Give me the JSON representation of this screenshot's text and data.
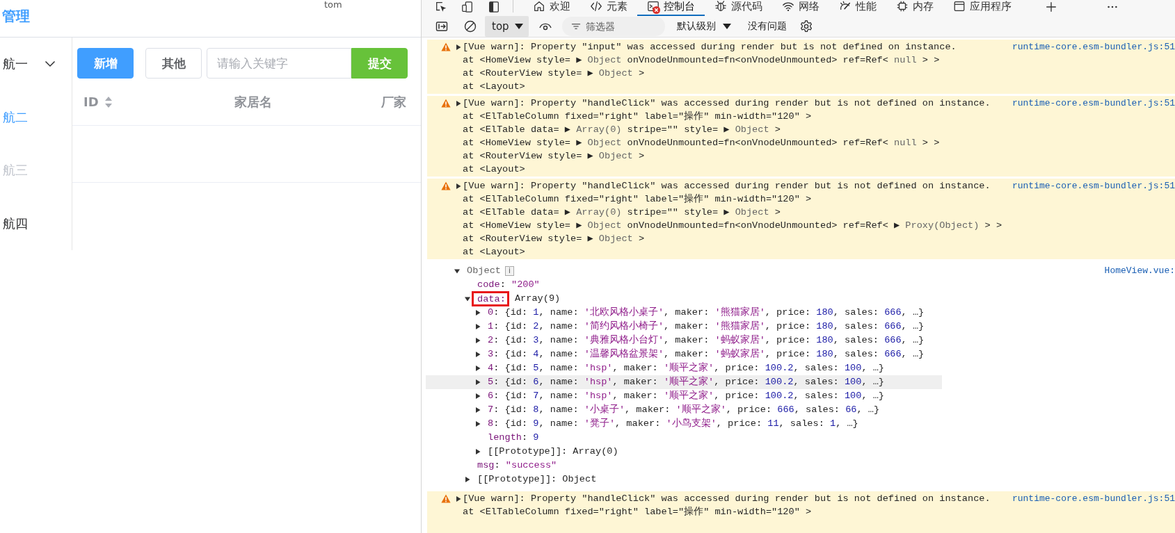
{
  "app": {
    "title": "管理",
    "user": "tom",
    "sidebar": [
      {
        "label": "航一",
        "selected": false,
        "disabled": false,
        "expanded": false,
        "kind": "submenu"
      },
      {
        "label": "航二",
        "selected": true,
        "disabled": false,
        "kind": "item"
      },
      {
        "label": "航三",
        "selected": false,
        "disabled": true,
        "kind": "item"
      },
      {
        "label": "航四",
        "selected": false,
        "disabled": false,
        "kind": "item"
      }
    ],
    "toolbar": {
      "buttons": [
        {
          "label": "新增",
          "kind": "primary"
        },
        {
          "label": "其他",
          "kind": "default"
        }
      ],
      "search": {
        "placeholder": "请输入关键字"
      },
      "submit": {
        "label": "提交",
        "kind": "success"
      }
    },
    "table": {
      "columns": [
        {
          "label": "ID",
          "sortable": true
        },
        {
          "label": "家居名",
          "sortable": false
        },
        {
          "label": "厂家",
          "sortable": false
        }
      ]
    }
  },
  "devtools": {
    "tabs": [
      {
        "label": "欢迎",
        "selected": false,
        "error_badge": false
      },
      {
        "label": "元素",
        "selected": false,
        "error_badge": false
      },
      {
        "label": "控制台",
        "selected": true,
        "error_badge": true
      },
      {
        "label": "源代码",
        "selected": false,
        "error_badge": false
      },
      {
        "label": "网络",
        "selected": false,
        "error_badge": false
      },
      {
        "label": "性能",
        "selected": false,
        "error_badge": false
      },
      {
        "label": "内存",
        "selected": false,
        "error_badge": false
      },
      {
        "label": "应用程序",
        "selected": false,
        "error_badge": false
      }
    ],
    "console_toolbar": {
      "context": "top",
      "filter": {
        "placeholder": "筛选器"
      },
      "level": "默认级别",
      "issues": "没有问题"
    },
    "messages": [
      {
        "kind": "warning",
        "collapsed": true,
        "source": "runtime-core.esm-bundler.js:51",
        "lines": [
          [
            {
              "kind": "plain",
              "text": "[Vue warn]: Property \"input\" was accessed during render but is not defined on instance."
            }
          ],
          [
            {
              "kind": "plain",
              "text": "at <HomeView style= ▶ "
            },
            {
              "kind": "dim",
              "text": "Object"
            },
            {
              "kind": "plain",
              "text": " onVnodeUnmounted=fn<onVnodeUnmounted> ref=Ref< "
            },
            {
              "kind": "dim",
              "text": "null"
            },
            {
              "kind": "plain",
              "text": " > >"
            }
          ],
          [
            {
              "kind": "plain",
              "text": "at <RouterView style= ▶ "
            },
            {
              "kind": "dim",
              "text": "Object"
            },
            {
              "kind": "plain",
              "text": " >"
            }
          ],
          [
            {
              "kind": "plain",
              "text": "at <Layout>"
            }
          ]
        ]
      },
      {
        "kind": "warning",
        "collapsed": true,
        "source": "runtime-core.esm-bundler.js:51",
        "lines": [
          [
            {
              "kind": "plain",
              "text": "[Vue warn]: Property \"handleClick\" was accessed during render but is not defined on instance."
            }
          ],
          [
            {
              "kind": "plain",
              "text": "at <ElTableColumn fixed=\"right\" label=\"操作\" min-width=\"120\" >"
            }
          ],
          [
            {
              "kind": "plain",
              "text": "at <ElTable data= ▶ "
            },
            {
              "kind": "dim",
              "text": "Array(0)"
            },
            {
              "kind": "plain",
              "text": " stripe=\"\" style= ▶ "
            },
            {
              "kind": "dim",
              "text": "Object"
            },
            {
              "kind": "plain",
              "text": " >"
            }
          ],
          [
            {
              "kind": "plain",
              "text": "at <HomeView style= ▶ "
            },
            {
              "kind": "dim",
              "text": "Object"
            },
            {
              "kind": "plain",
              "text": " onVnodeUnmounted=fn<onVnodeUnmounted> ref=Ref< "
            },
            {
              "kind": "dim",
              "text": "null"
            },
            {
              "kind": "plain",
              "text": " > >"
            }
          ],
          [
            {
              "kind": "plain",
              "text": "at <RouterView style= ▶ "
            },
            {
              "kind": "dim",
              "text": "Object"
            },
            {
              "kind": "plain",
              "text": " >"
            }
          ],
          [
            {
              "kind": "plain",
              "text": "at <Layout>"
            }
          ]
        ]
      },
      {
        "kind": "warning",
        "collapsed": true,
        "source": "runtime-core.esm-bundler.js:51",
        "lines": [
          [
            {
              "kind": "plain",
              "text": "[Vue warn]: Property \"handleClick\" was accessed during render but is not defined on instance."
            }
          ],
          [
            {
              "kind": "plain",
              "text": "at <ElTableColumn fixed=\"right\" label=\"操作\" min-width=\"120\" >"
            }
          ],
          [
            {
              "kind": "plain",
              "text": "at <ElTable data= ▶ "
            },
            {
              "kind": "dim",
              "text": "Array(0)"
            },
            {
              "kind": "plain",
              "text": " stripe=\"\" style= ▶ "
            },
            {
              "kind": "dim",
              "text": "Object"
            },
            {
              "kind": "plain",
              "text": " >"
            }
          ],
          [
            {
              "kind": "plain",
              "text": "at <HomeView style= ▶ "
            },
            {
              "kind": "dim",
              "text": "Object"
            },
            {
              "kind": "plain",
              "text": " onVnodeUnmounted=fn<onVnodeUnmounted> ref=Ref< ▶ "
            },
            {
              "kind": "dim",
              "text": "Proxy(Object)"
            },
            {
              "kind": "plain",
              "text": " > >"
            }
          ],
          [
            {
              "kind": "plain",
              "text": "at <RouterView style= ▶ "
            },
            {
              "kind": "dim",
              "text": "Object"
            },
            {
              "kind": "plain",
              "text": " >"
            }
          ],
          [
            {
              "kind": "plain",
              "text": "at <Layout>"
            }
          ]
        ]
      },
      {
        "kind": "object",
        "source": "HomeView.vue:",
        "rows": [
          {
            "segs": [
              {
                "kind": "dim",
                "text": "Object"
              }
            ],
            "badge": "i",
            "expanded": true,
            "hovered": false,
            "children": [
              {
                "segs": [
                  {
                    "kind": "key",
                    "text": "code"
                  },
                  {
                    "kind": "plain",
                    "text": ": "
                  },
                  {
                    "kind": "string",
                    "text": "\"200\""
                  }
                ],
                "hovered": false
              },
              {
                "segs": [
                  {
                    "kind": "boxed",
                    "text": "data:"
                  },
                  {
                    "kind": "plain",
                    "text": " Array(9)"
                  }
                ],
                "expanded": true,
                "hovered": false,
                "children": [
                  {
                    "segs": [
                      {
                        "kind": "index",
                        "text": "0"
                      },
                      {
                        "kind": "plain",
                        "text": ": {id: "
                      },
                      {
                        "kind": "number",
                        "text": "1"
                      },
                      {
                        "kind": "plain",
                        "text": ", name: "
                      },
                      {
                        "kind": "string",
                        "text": "'北欧风格小桌子'"
                      },
                      {
                        "kind": "plain",
                        "text": ", maker: "
                      },
                      {
                        "kind": "string",
                        "text": "'熊猫家居'"
                      },
                      {
                        "kind": "plain",
                        "text": ", price: "
                      },
                      {
                        "kind": "number",
                        "text": "180"
                      },
                      {
                        "kind": "plain",
                        "text": ", sales: "
                      },
                      {
                        "kind": "number",
                        "text": "666"
                      },
                      {
                        "kind": "plain",
                        "text": ", …}"
                      }
                    ],
                    "expanded": false,
                    "hovered": false
                  },
                  {
                    "segs": [
                      {
                        "kind": "index",
                        "text": "1"
                      },
                      {
                        "kind": "plain",
                        "text": ": {id: "
                      },
                      {
                        "kind": "number",
                        "text": "2"
                      },
                      {
                        "kind": "plain",
                        "text": ", name: "
                      },
                      {
                        "kind": "string",
                        "text": "'简约风格小椅子'"
                      },
                      {
                        "kind": "plain",
                        "text": ", maker: "
                      },
                      {
                        "kind": "string",
                        "text": "'熊猫家居'"
                      },
                      {
                        "kind": "plain",
                        "text": ", price: "
                      },
                      {
                        "kind": "number",
                        "text": "180"
                      },
                      {
                        "kind": "plain",
                        "text": ", sales: "
                      },
                      {
                        "kind": "number",
                        "text": "666"
                      },
                      {
                        "kind": "plain",
                        "text": ", …}"
                      }
                    ],
                    "expanded": false,
                    "hovered": false
                  },
                  {
                    "segs": [
                      {
                        "kind": "index",
                        "text": "2"
                      },
                      {
                        "kind": "plain",
                        "text": ": {id: "
                      },
                      {
                        "kind": "number",
                        "text": "3"
                      },
                      {
                        "kind": "plain",
                        "text": ", name: "
                      },
                      {
                        "kind": "string",
                        "text": "'典雅风格小台灯'"
                      },
                      {
                        "kind": "plain",
                        "text": ", maker: "
                      },
                      {
                        "kind": "string",
                        "text": "'蚂蚁家居'"
                      },
                      {
                        "kind": "plain",
                        "text": ", price: "
                      },
                      {
                        "kind": "number",
                        "text": "180"
                      },
                      {
                        "kind": "plain",
                        "text": ", sales: "
                      },
                      {
                        "kind": "number",
                        "text": "666"
                      },
                      {
                        "kind": "plain",
                        "text": ", …}"
                      }
                    ],
                    "expanded": false,
                    "hovered": false
                  },
                  {
                    "segs": [
                      {
                        "kind": "index",
                        "text": "3"
                      },
                      {
                        "kind": "plain",
                        "text": ": {id: "
                      },
                      {
                        "kind": "number",
                        "text": "4"
                      },
                      {
                        "kind": "plain",
                        "text": ", name: "
                      },
                      {
                        "kind": "string",
                        "text": "'温馨风格盆景架'"
                      },
                      {
                        "kind": "plain",
                        "text": ", maker: "
                      },
                      {
                        "kind": "string",
                        "text": "'蚂蚁家居'"
                      },
                      {
                        "kind": "plain",
                        "text": ", price: "
                      },
                      {
                        "kind": "number",
                        "text": "180"
                      },
                      {
                        "kind": "plain",
                        "text": ", sales: "
                      },
                      {
                        "kind": "number",
                        "text": "666"
                      },
                      {
                        "kind": "plain",
                        "text": ", …}"
                      }
                    ],
                    "expanded": false,
                    "hovered": false
                  },
                  {
                    "segs": [
                      {
                        "kind": "index",
                        "text": "4"
                      },
                      {
                        "kind": "plain",
                        "text": ": {id: "
                      },
                      {
                        "kind": "number",
                        "text": "5"
                      },
                      {
                        "kind": "plain",
                        "text": ", name: "
                      },
                      {
                        "kind": "string",
                        "text": "'hsp'"
                      },
                      {
                        "kind": "plain",
                        "text": ", maker: "
                      },
                      {
                        "kind": "string",
                        "text": "'顺平之家'"
                      },
                      {
                        "kind": "plain",
                        "text": ", price: "
                      },
                      {
                        "kind": "number",
                        "text": "100.2"
                      },
                      {
                        "kind": "plain",
                        "text": ", sales: "
                      },
                      {
                        "kind": "number",
                        "text": "100"
                      },
                      {
                        "kind": "plain",
                        "text": ", …}"
                      }
                    ],
                    "expanded": false,
                    "hovered": false
                  },
                  {
                    "segs": [
                      {
                        "kind": "index",
                        "text": "5"
                      },
                      {
                        "kind": "plain",
                        "text": ": {id: "
                      },
                      {
                        "kind": "number",
                        "text": "6"
                      },
                      {
                        "kind": "plain",
                        "text": ", name: "
                      },
                      {
                        "kind": "string",
                        "text": "'hsp'"
                      },
                      {
                        "kind": "plain",
                        "text": ", maker: "
                      },
                      {
                        "kind": "string",
                        "text": "'顺平之家'"
                      },
                      {
                        "kind": "plain",
                        "text": ", price: "
                      },
                      {
                        "kind": "number",
                        "text": "100.2"
                      },
                      {
                        "kind": "plain",
                        "text": ", sales: "
                      },
                      {
                        "kind": "number",
                        "text": "100"
                      },
                      {
                        "kind": "plain",
                        "text": ", …}"
                      }
                    ],
                    "expanded": false,
                    "hovered": true
                  },
                  {
                    "segs": [
                      {
                        "kind": "index",
                        "text": "6"
                      },
                      {
                        "kind": "plain",
                        "text": ": {id: "
                      },
                      {
                        "kind": "number",
                        "text": "7"
                      },
                      {
                        "kind": "plain",
                        "text": ", name: "
                      },
                      {
                        "kind": "string",
                        "text": "'hsp'"
                      },
                      {
                        "kind": "plain",
                        "text": ", maker: "
                      },
                      {
                        "kind": "string",
                        "text": "'顺平之家'"
                      },
                      {
                        "kind": "plain",
                        "text": ", price: "
                      },
                      {
                        "kind": "number",
                        "text": "100.2"
                      },
                      {
                        "kind": "plain",
                        "text": ", sales: "
                      },
                      {
                        "kind": "number",
                        "text": "100"
                      },
                      {
                        "kind": "plain",
                        "text": ", …}"
                      }
                    ],
                    "expanded": false,
                    "hovered": false
                  },
                  {
                    "segs": [
                      {
                        "kind": "index",
                        "text": "7"
                      },
                      {
                        "kind": "plain",
                        "text": ": {id: "
                      },
                      {
                        "kind": "number",
                        "text": "8"
                      },
                      {
                        "kind": "plain",
                        "text": ", name: "
                      },
                      {
                        "kind": "string",
                        "text": "'小桌子'"
                      },
                      {
                        "kind": "plain",
                        "text": ", maker: "
                      },
                      {
                        "kind": "string",
                        "text": "'顺平之家'"
                      },
                      {
                        "kind": "plain",
                        "text": ", price: "
                      },
                      {
                        "kind": "number",
                        "text": "666"
                      },
                      {
                        "kind": "plain",
                        "text": ", sales: "
                      },
                      {
                        "kind": "number",
                        "text": "66"
                      },
                      {
                        "kind": "plain",
                        "text": ", …}"
                      }
                    ],
                    "expanded": false,
                    "hovered": false
                  },
                  {
                    "segs": [
                      {
                        "kind": "index",
                        "text": "8"
                      },
                      {
                        "kind": "plain",
                        "text": ": {id: "
                      },
                      {
                        "kind": "number",
                        "text": "9"
                      },
                      {
                        "kind": "plain",
                        "text": ", name: "
                      },
                      {
                        "kind": "string",
                        "text": "'凳子'"
                      },
                      {
                        "kind": "plain",
                        "text": ", maker: "
                      },
                      {
                        "kind": "string",
                        "text": "'小鸟支架'"
                      },
                      {
                        "kind": "plain",
                        "text": ", price: "
                      },
                      {
                        "kind": "number",
                        "text": "11"
                      },
                      {
                        "kind": "plain",
                        "text": ", sales: "
                      },
                      {
                        "kind": "number",
                        "text": "1"
                      },
                      {
                        "kind": "plain",
                        "text": ", …}"
                      }
                    ],
                    "expanded": false,
                    "hovered": false
                  },
                  {
                    "segs": [
                      {
                        "kind": "key",
                        "text": "length"
                      },
                      {
                        "kind": "plain",
                        "text": ": "
                      },
                      {
                        "kind": "number",
                        "text": "9"
                      }
                    ],
                    "hovered": false
                  },
                  {
                    "segs": [
                      {
                        "kind": "plain",
                        "text": "[[Prototype]]: Array(0)"
                      }
                    ],
                    "expanded": false,
                    "hovered": false
                  }
                ]
              },
              {
                "segs": [
                  {
                    "kind": "key",
                    "text": "msg"
                  },
                  {
                    "kind": "plain",
                    "text": ": "
                  },
                  {
                    "kind": "string",
                    "text": "\"success\""
                  }
                ],
                "hovered": false
              },
              {
                "segs": [
                  {
                    "kind": "plain",
                    "text": "[[Prototype]]: Object"
                  }
                ],
                "expanded": false,
                "hovered": false
              }
            ]
          }
        ]
      },
      {
        "kind": "warning",
        "collapsed": true,
        "source": "runtime-core.esm-bundler.js:51",
        "lines": [
          [
            {
              "kind": "plain",
              "text": "[Vue warn]: Property \"handleClick\" was accessed during render but is not defined on instance."
            }
          ],
          [
            {
              "kind": "plain",
              "text": "at <ElTableColumn fixed=\"right\" label=\"操作\" min-width=\"120\" >"
            }
          ]
        ]
      }
    ]
  }
}
